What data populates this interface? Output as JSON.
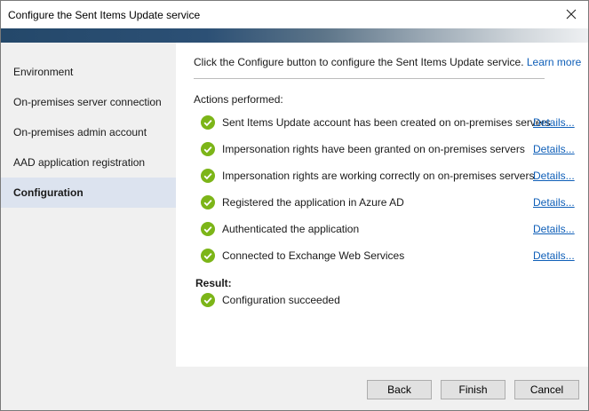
{
  "window": {
    "title": "Configure the Sent Items Update service"
  },
  "sidebar": {
    "items": [
      {
        "label": "Environment",
        "active": false
      },
      {
        "label": "On-premises server connection",
        "active": false
      },
      {
        "label": "On-premises admin account",
        "active": false
      },
      {
        "label": "AAD application registration",
        "active": false
      },
      {
        "label": "Configuration",
        "active": true
      }
    ]
  },
  "content": {
    "intro_text": "Click the Configure button to configure the Sent Items Update service.",
    "learn_more": "Learn more",
    "actions_label": "Actions performed:",
    "actions": [
      {
        "text": "Sent Items Update account has been created on on-premises servers",
        "details": "Details..."
      },
      {
        "text": "Impersonation rights have been granted on on-premises servers",
        "details": "Details..."
      },
      {
        "text": "Impersonation rights are working correctly on on-premises servers",
        "details": "Details..."
      },
      {
        "text": "Registered the application in Azure AD",
        "details": "Details..."
      },
      {
        "text": "Authenticated the application",
        "details": "Details..."
      },
      {
        "text": "Connected to Exchange Web Services",
        "details": "Details..."
      }
    ],
    "result_label": "Result:",
    "result_text": "Configuration succeeded"
  },
  "footer": {
    "back": "Back",
    "finish": "Finish",
    "cancel": "Cancel"
  },
  "colors": {
    "success": "#7cb518",
    "link": "#0f5fb8",
    "active_nav": "#dce3ef"
  },
  "icons": {
    "status": "check-circle-icon",
    "close": "close-icon"
  }
}
